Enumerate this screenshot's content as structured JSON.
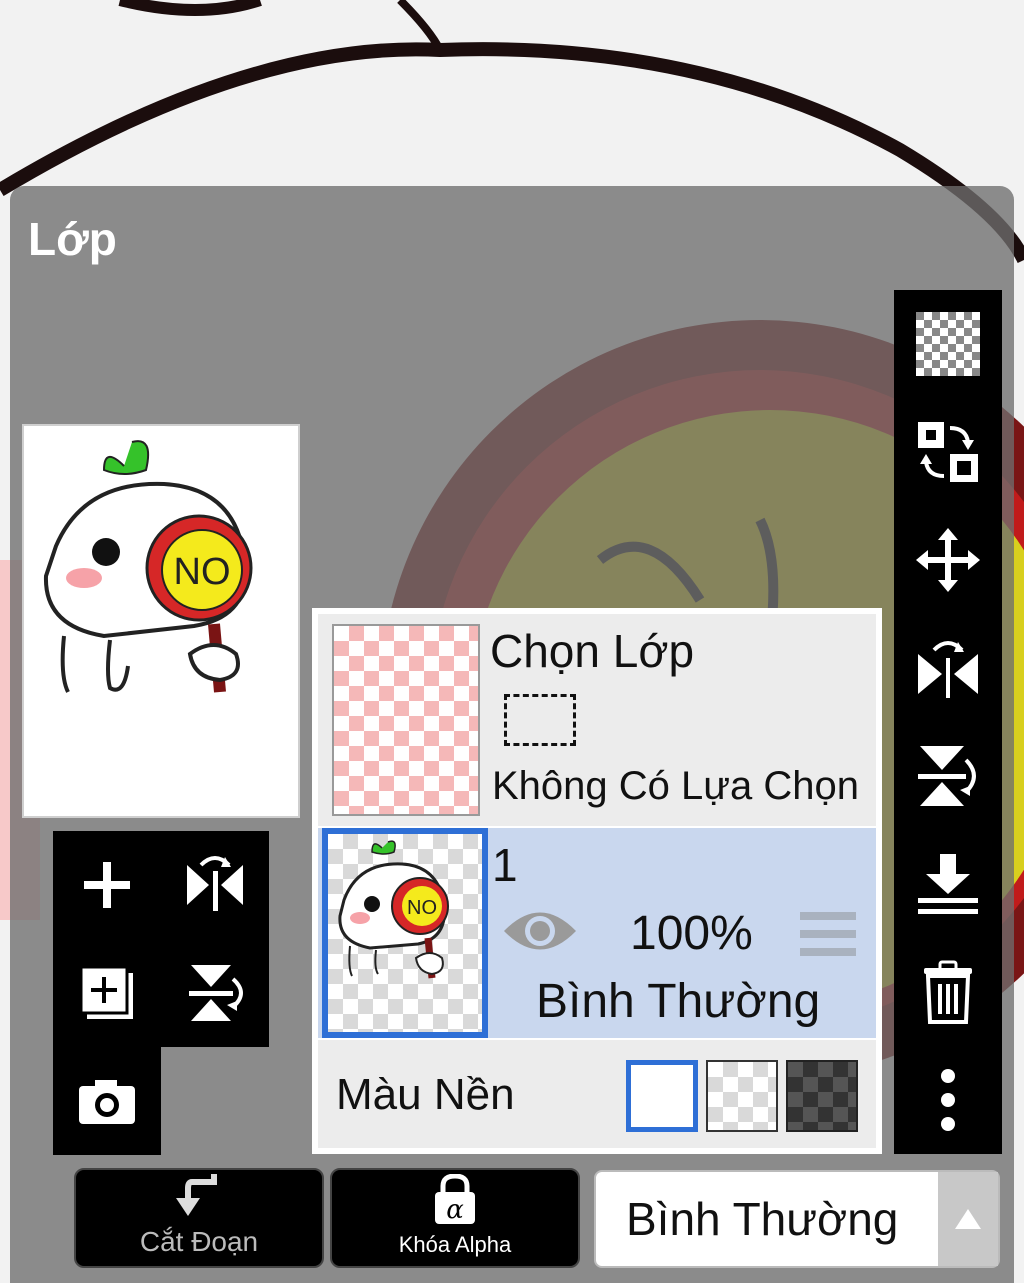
{
  "panel": {
    "title": "Lớp"
  },
  "selection_layer": {
    "title": "Chọn Lớp",
    "status": "Không Có Lựa Chọn"
  },
  "layer": {
    "name": "1",
    "opacity": "100%",
    "blend_mode": "Bình Thường"
  },
  "preview": {
    "sticker_text": "NO"
  },
  "background": {
    "label": "Màu Nền",
    "options": [
      "white",
      "transparent",
      "dark"
    ],
    "selected": "white"
  },
  "bottom_bar": {
    "clipping_label": "Cắt Đoạn",
    "alpha_lock_label": "Khóa Alpha",
    "blend_select_value": "Bình Thường"
  },
  "left_tools": [
    "plus-icon",
    "flip-horizontal-icon",
    "add-layer-icon",
    "flip-vertical-icon",
    "camera-icon"
  ],
  "right_toolbar": [
    "transparency-icon",
    "swap-layers-icon",
    "move-icon",
    "flip-horizontal-icon",
    "flip-vertical-icon",
    "merge-down-icon",
    "trash-icon",
    "more-vertical-icon"
  ],
  "colors": {
    "accent": "#2e6fd6",
    "active_layer_bg": "#c9d7ee",
    "toolbar_bg": "#000000"
  }
}
